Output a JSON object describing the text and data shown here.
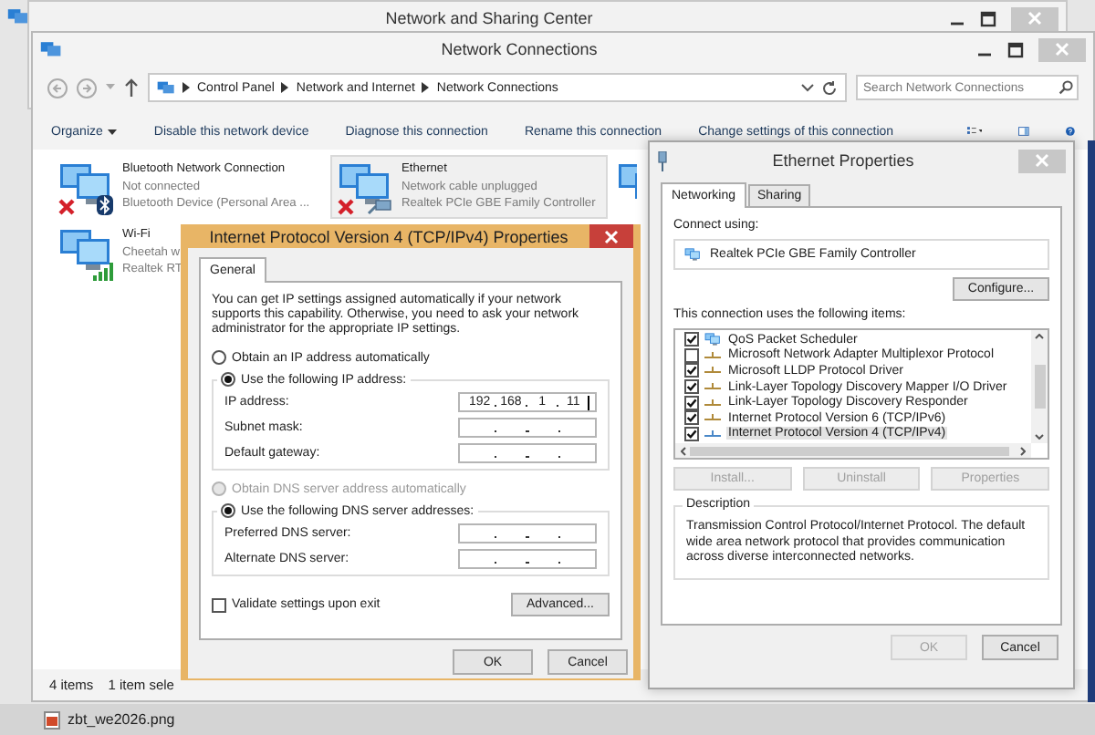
{
  "back_window": {
    "title": "Network and Sharing Center"
  },
  "explorer": {
    "title": "Network Connections",
    "breadcrumb": [
      "Control Panel",
      "Network and Internet",
      "Network Connections"
    ],
    "search": {
      "placeholder": "Search Network Connections"
    },
    "toolbar": [
      {
        "label": "Organize",
        "kind": "menu"
      },
      {
        "label": "Disable this network device",
        "kind": "command"
      },
      {
        "label": "Diagnose this connection",
        "kind": "command"
      },
      {
        "label": "Rename this connection",
        "kind": "command"
      },
      {
        "label": "Change settings of this connection",
        "kind": "command"
      }
    ],
    "connections": [
      {
        "kind": "bluetooth",
        "name": "Bluetooth Network Connection",
        "status": "Not connected",
        "device": "Bluetooth Device (Personal Area ...",
        "selected": false,
        "disconnected": true
      },
      {
        "kind": "ethernet",
        "name": "Ethernet",
        "status": "Network cable unplugged",
        "device": "Realtek PCIe GBE Family Controller",
        "selected": true,
        "disconnected": true
      },
      {
        "kind": "network",
        "selected": false
      },
      {
        "kind": "wifi",
        "name": "Wi-Fi",
        "status": "Cheetah w",
        "device": "Realtek RT",
        "selected": false,
        "disconnected": false
      }
    ],
    "status_bar": {
      "count": "4 items",
      "selection": "1 item sele"
    }
  },
  "ethernet_properties": {
    "title": "Ethernet Properties",
    "tabs": [
      {
        "label": "Networking",
        "selected": true
      },
      {
        "label": "Sharing",
        "selected": false
      }
    ],
    "connect_using": "Connect using:",
    "adapter": "Realtek PCIe GBE Family Controller",
    "configure": "Configure...",
    "items_label": "This connection uses the following items:",
    "items": [
      {
        "kind": "service",
        "label": "QoS Packet Scheduler",
        "checked": true,
        "selected": false
      },
      {
        "kind": "protocol",
        "label": "Microsoft Network Adapter Multiplexor Protocol",
        "checked": false,
        "selected": false
      },
      {
        "kind": "protocol",
        "label": "Microsoft LLDP Protocol Driver",
        "checked": true,
        "selected": false
      },
      {
        "kind": "protocol",
        "label": "Link-Layer Topology Discovery Mapper I/O Driver",
        "checked": true,
        "selected": false
      },
      {
        "kind": "protocol",
        "label": "Link-Layer Topology Discovery Responder",
        "checked": true,
        "selected": false
      },
      {
        "kind": "protocol",
        "label": "Internet Protocol Version 6 (TCP/IPv6)",
        "checked": true,
        "selected": false
      },
      {
        "kind": "protocol",
        "label": "Internet Protocol Version 4 (TCP/IPv4)",
        "checked": true,
        "selected": true
      }
    ],
    "item_buttons": [
      {
        "label": "Install...",
        "disabled": true
      },
      {
        "label": "Uninstall",
        "disabled": true
      },
      {
        "label": "Properties",
        "disabled": true
      }
    ],
    "description": {
      "legend": "Description",
      "text": "Transmission Control Protocol/Internet Protocol. The default wide area network protocol that provides communication across diverse interconnected networks."
    },
    "buttons": [
      {
        "label": "OK",
        "disabled": true
      },
      {
        "label": "Cancel",
        "disabled": false
      }
    ]
  },
  "ipv4_dialog": {
    "title": "Internet Protocol Version 4 (TCP/IPv4) Properties",
    "tabs": [
      {
        "label": "General",
        "selected": true
      }
    ],
    "intro": "You can get IP settings assigned automatically if your network supports this capability. Otherwise, you need to ask your network administrator for the appropriate IP settings.",
    "ip_mode": [
      {
        "label": "Obtain an IP address automatically",
        "selected": false,
        "disabled": false
      },
      {
        "label": "Use the following IP address:",
        "selected": true,
        "disabled": false
      }
    ],
    "ip_fields": [
      {
        "label": "IP address:",
        "octets": [
          "192",
          "168",
          "1",
          "11"
        ],
        "focused": true
      },
      {
        "label": "Subnet mask:",
        "focused": false
      },
      {
        "label": "Default gateway:",
        "focused": false
      }
    ],
    "dns_mode": [
      {
        "label": "Obtain DNS server address automatically",
        "selected": false,
        "disabled": true
      },
      {
        "label": "Use the following DNS server addresses:",
        "selected": true,
        "disabled": false
      }
    ],
    "dns_fields": [
      {
        "label": "Preferred DNS server:",
        "focused": false
      },
      {
        "label": "Alternate DNS server:",
        "focused": false
      }
    ],
    "validate": {
      "label": "Validate settings upon exit",
      "checked": false
    },
    "advanced": "Advanced...",
    "buttons": [
      {
        "label": "OK"
      },
      {
        "label": "Cancel"
      }
    ]
  },
  "taskbar": {
    "items": [
      {
        "label": "zbt_we2026.png"
      }
    ]
  }
}
